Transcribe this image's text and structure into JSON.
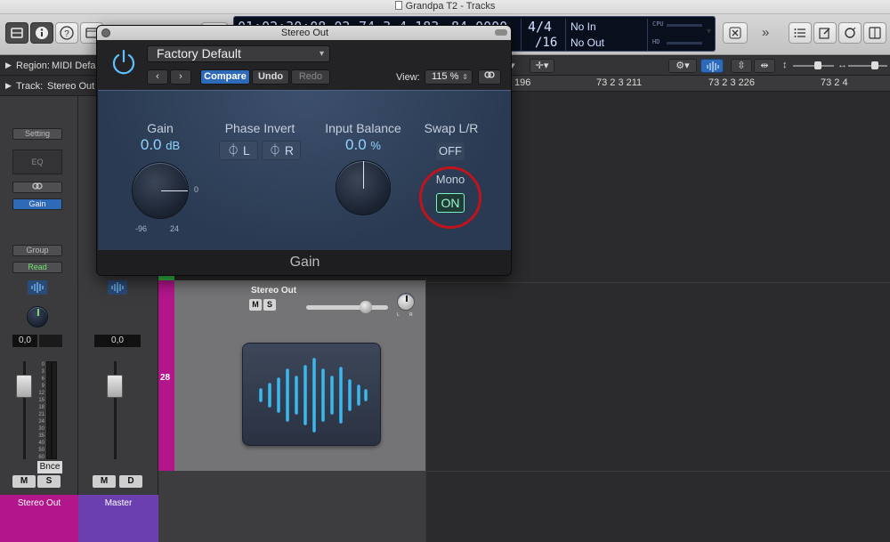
{
  "window": {
    "title": "Grandpa T2 - Tracks"
  },
  "lcd": {
    "timecode": "01:02:30:08.02",
    "position": "74  3  4  183",
    "tempo": "84.0000",
    "sig_top": "4/4",
    "sig_bottom": "/16",
    "midi_in": "No In",
    "midi_out": "No Out",
    "cpu_label": "CPU",
    "hd_label": "HD"
  },
  "inspector": {
    "region_label": "Region:",
    "region_value": "MIDI Defau",
    "track_label": "Track:",
    "track_value": "Stereo Out"
  },
  "strip1": {
    "setting": "Setting",
    "eq": "EQ",
    "gain": "Gain",
    "group": "Group",
    "read": "Read",
    "pan_value": "0,0",
    "bounce": "Bnce",
    "mute": "M",
    "solo": "S",
    "name": "Stereo Out",
    "scale": [
      "0",
      "3",
      "6",
      "9",
      "12",
      "15",
      "18",
      "21",
      "24",
      "30",
      "35",
      "40",
      "50",
      "60"
    ]
  },
  "strip2": {
    "pan_value": "0,0",
    "mute": "M",
    "dim": "D",
    "name": "Master"
  },
  "ruler": {
    "marks": [
      "196",
      "73 2 3 211",
      "73 2 3 226",
      "73 2 4"
    ]
  },
  "track": {
    "number": "28",
    "name": "Stereo Out",
    "mute": "M",
    "solo": "S",
    "pan_l": "L",
    "pan_r": "R"
  },
  "plugin": {
    "window_title": "Stereo Out",
    "preset": "Factory Default",
    "compare": "Compare",
    "undo": "Undo",
    "redo": "Redo",
    "view_label": "View:",
    "view_value": "115 %",
    "gain_label": "Gain",
    "gain_value": "0.0",
    "gain_unit": "dB",
    "gain_min": "-96",
    "gain_max": "24",
    "gain_zero": "0",
    "phase_label": "Phase Invert",
    "phase_l": "L",
    "phase_r": "R",
    "balance_label": "Input Balance",
    "balance_value": "0.0",
    "balance_unit": "%",
    "swap_label": "Swap L/R",
    "swap_value": "OFF",
    "mono_label": "Mono",
    "mono_value": "ON",
    "footer": "Gain",
    "highlight_color": "#c0141c"
  }
}
